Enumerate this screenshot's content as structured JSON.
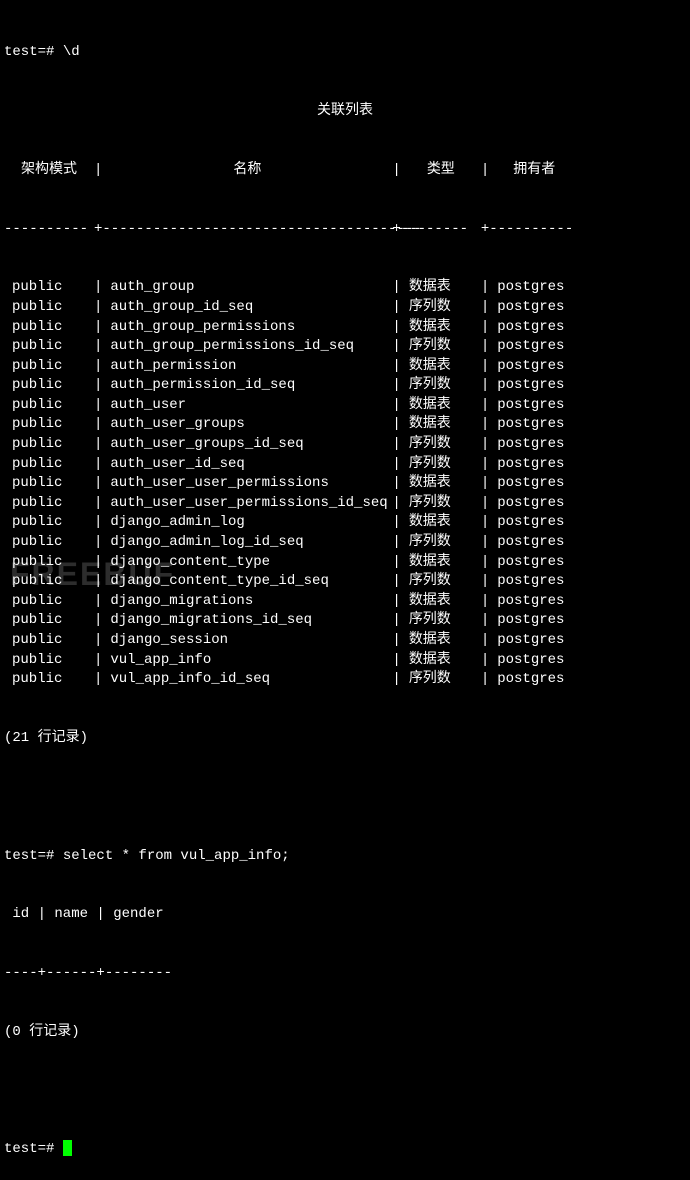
{
  "prompt1": {
    "prefix": "test=# ",
    "command": "\\d"
  },
  "table": {
    "title": "关联列表",
    "headers": {
      "schema": "架构模式",
      "name": "名称",
      "type": "类型",
      "owner": "拥有者"
    },
    "separator": {
      "schema": "----------",
      "name": "--------------------------------------",
      "type": "--------",
      "owner": "----------"
    },
    "rows": [
      {
        "schema": "public",
        "name": "auth_group",
        "type": "数据表",
        "owner": "postgres"
      },
      {
        "schema": "public",
        "name": "auth_group_id_seq",
        "type": "序列数",
        "owner": "postgres"
      },
      {
        "schema": "public",
        "name": "auth_group_permissions",
        "type": "数据表",
        "owner": "postgres"
      },
      {
        "schema": "public",
        "name": "auth_group_permissions_id_seq",
        "type": "序列数",
        "owner": "postgres"
      },
      {
        "schema": "public",
        "name": "auth_permission",
        "type": "数据表",
        "owner": "postgres"
      },
      {
        "schema": "public",
        "name": "auth_permission_id_seq",
        "type": "序列数",
        "owner": "postgres"
      },
      {
        "schema": "public",
        "name": "auth_user",
        "type": "数据表",
        "owner": "postgres"
      },
      {
        "schema": "public",
        "name": "auth_user_groups",
        "type": "数据表",
        "owner": "postgres"
      },
      {
        "schema": "public",
        "name": "auth_user_groups_id_seq",
        "type": "序列数",
        "owner": "postgres"
      },
      {
        "schema": "public",
        "name": "auth_user_id_seq",
        "type": "序列数",
        "owner": "postgres"
      },
      {
        "schema": "public",
        "name": "auth_user_user_permissions",
        "type": "数据表",
        "owner": "postgres"
      },
      {
        "schema": "public",
        "name": "auth_user_user_permissions_id_seq",
        "type": "序列数",
        "owner": "postgres"
      },
      {
        "schema": "public",
        "name": "django_admin_log",
        "type": "数据表",
        "owner": "postgres"
      },
      {
        "schema": "public",
        "name": "django_admin_log_id_seq",
        "type": "序列数",
        "owner": "postgres"
      },
      {
        "schema": "public",
        "name": "django_content_type",
        "type": "数据表",
        "owner": "postgres"
      },
      {
        "schema": "public",
        "name": "django_content_type_id_seq",
        "type": "序列数",
        "owner": "postgres"
      },
      {
        "schema": "public",
        "name": "django_migrations",
        "type": "数据表",
        "owner": "postgres"
      },
      {
        "schema": "public",
        "name": "django_migrations_id_seq",
        "type": "序列数",
        "owner": "postgres"
      },
      {
        "schema": "public",
        "name": "django_session",
        "type": "数据表",
        "owner": "postgres"
      },
      {
        "schema": "public",
        "name": "vul_app_info",
        "type": "数据表",
        "owner": "postgres"
      },
      {
        "schema": "public",
        "name": "vul_app_info_id_seq",
        "type": "序列数",
        "owner": "postgres"
      }
    ],
    "footer": "(21 行记录)"
  },
  "prompt2": {
    "prefix": "test=# ",
    "command": "select * from vul_app_info;"
  },
  "result2": {
    "header": " id | name | gender",
    "separator": "----+------+--------",
    "footer": "(0 行记录)"
  },
  "prompt3": {
    "prefix": "test=# "
  },
  "watermark": "FREEBUF"
}
